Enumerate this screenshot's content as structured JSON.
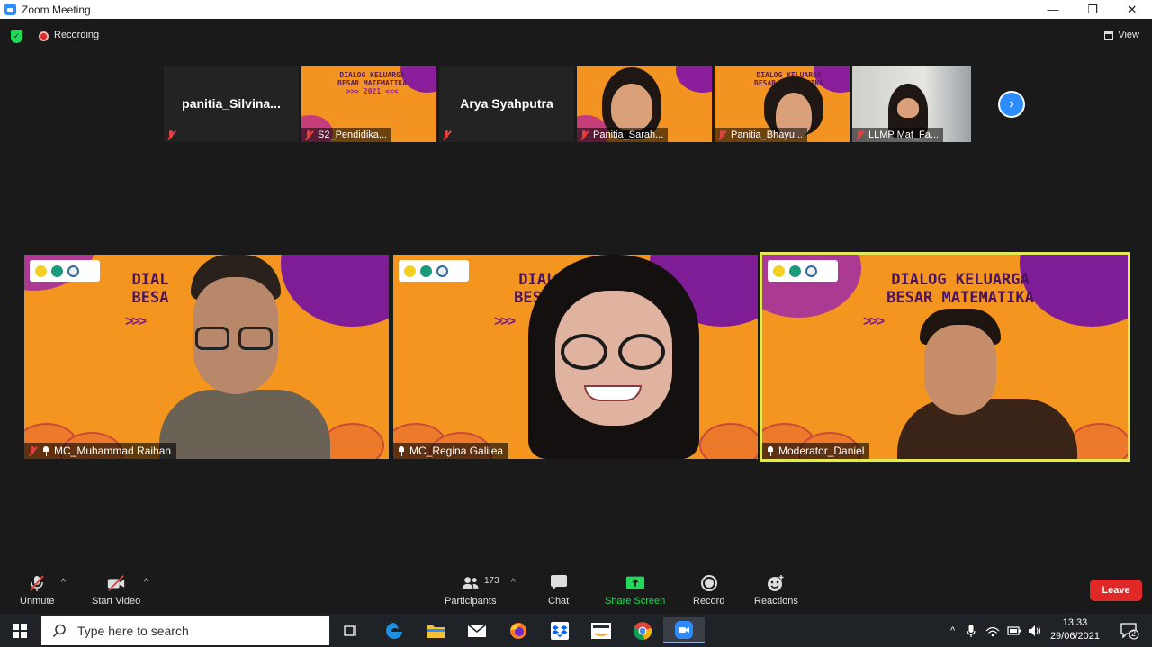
{
  "window": {
    "title": "Zoom Meeting",
    "minimize": "—",
    "restore": "❐",
    "close": "✕"
  },
  "topbar": {
    "recording_label": "Recording",
    "view_label": "View"
  },
  "thumbnails": [
    {
      "name": "panitia_Silvina...",
      "label": "",
      "type": "name"
    },
    {
      "name": "",
      "label": "S2_Pendidika...",
      "type": "poster"
    },
    {
      "name": "Arya Syahputra",
      "label": "",
      "type": "name"
    },
    {
      "name": "",
      "label": "Panitia_Sarah...",
      "type": "poster"
    },
    {
      "name": "",
      "label": "Panitia_Bhayu...",
      "type": "poster"
    },
    {
      "name": "",
      "label": "LLMP Mat_Fa...",
      "type": "room"
    }
  ],
  "poster_text": {
    "line1": "DIALOG KELUARGA",
    "line2": "BESAR MATEMATIKA",
    "year": ">>> 2021 <<<"
  },
  "tiles": [
    {
      "label": "MC_Muhammad Raihan",
      "heading1": "DIAL",
      "heading2": "BESA",
      "muted": true
    },
    {
      "label": "MC_Regina Galilea",
      "heading1": "DIALOG",
      "heading2": "BESAR M",
      "muted": false
    },
    {
      "label": "Moderator_Daniel",
      "heading1": "DIALOG KELUARGA",
      "heading2": "BESAR MATEMATIKA",
      "muted": false
    }
  ],
  "tile_arrows": ">>>",
  "tile_year": "2021",
  "toolbar": {
    "unmute": "Unmute",
    "start_video": "Start Video",
    "participants": "Participants",
    "participant_count": "173",
    "chat": "Chat",
    "share_screen": "Share Screen",
    "record": "Record",
    "reactions": "Reactions",
    "leave": "Leave"
  },
  "taskbar": {
    "search_placeholder": "Type here to search",
    "time": "13:33",
    "date": "29/06/2021",
    "notification_count": "2"
  },
  "colors": {
    "accent": "#2d8cff",
    "leave": "#e02828",
    "share": "#23d959",
    "active_speaker": "#e3e85a"
  }
}
